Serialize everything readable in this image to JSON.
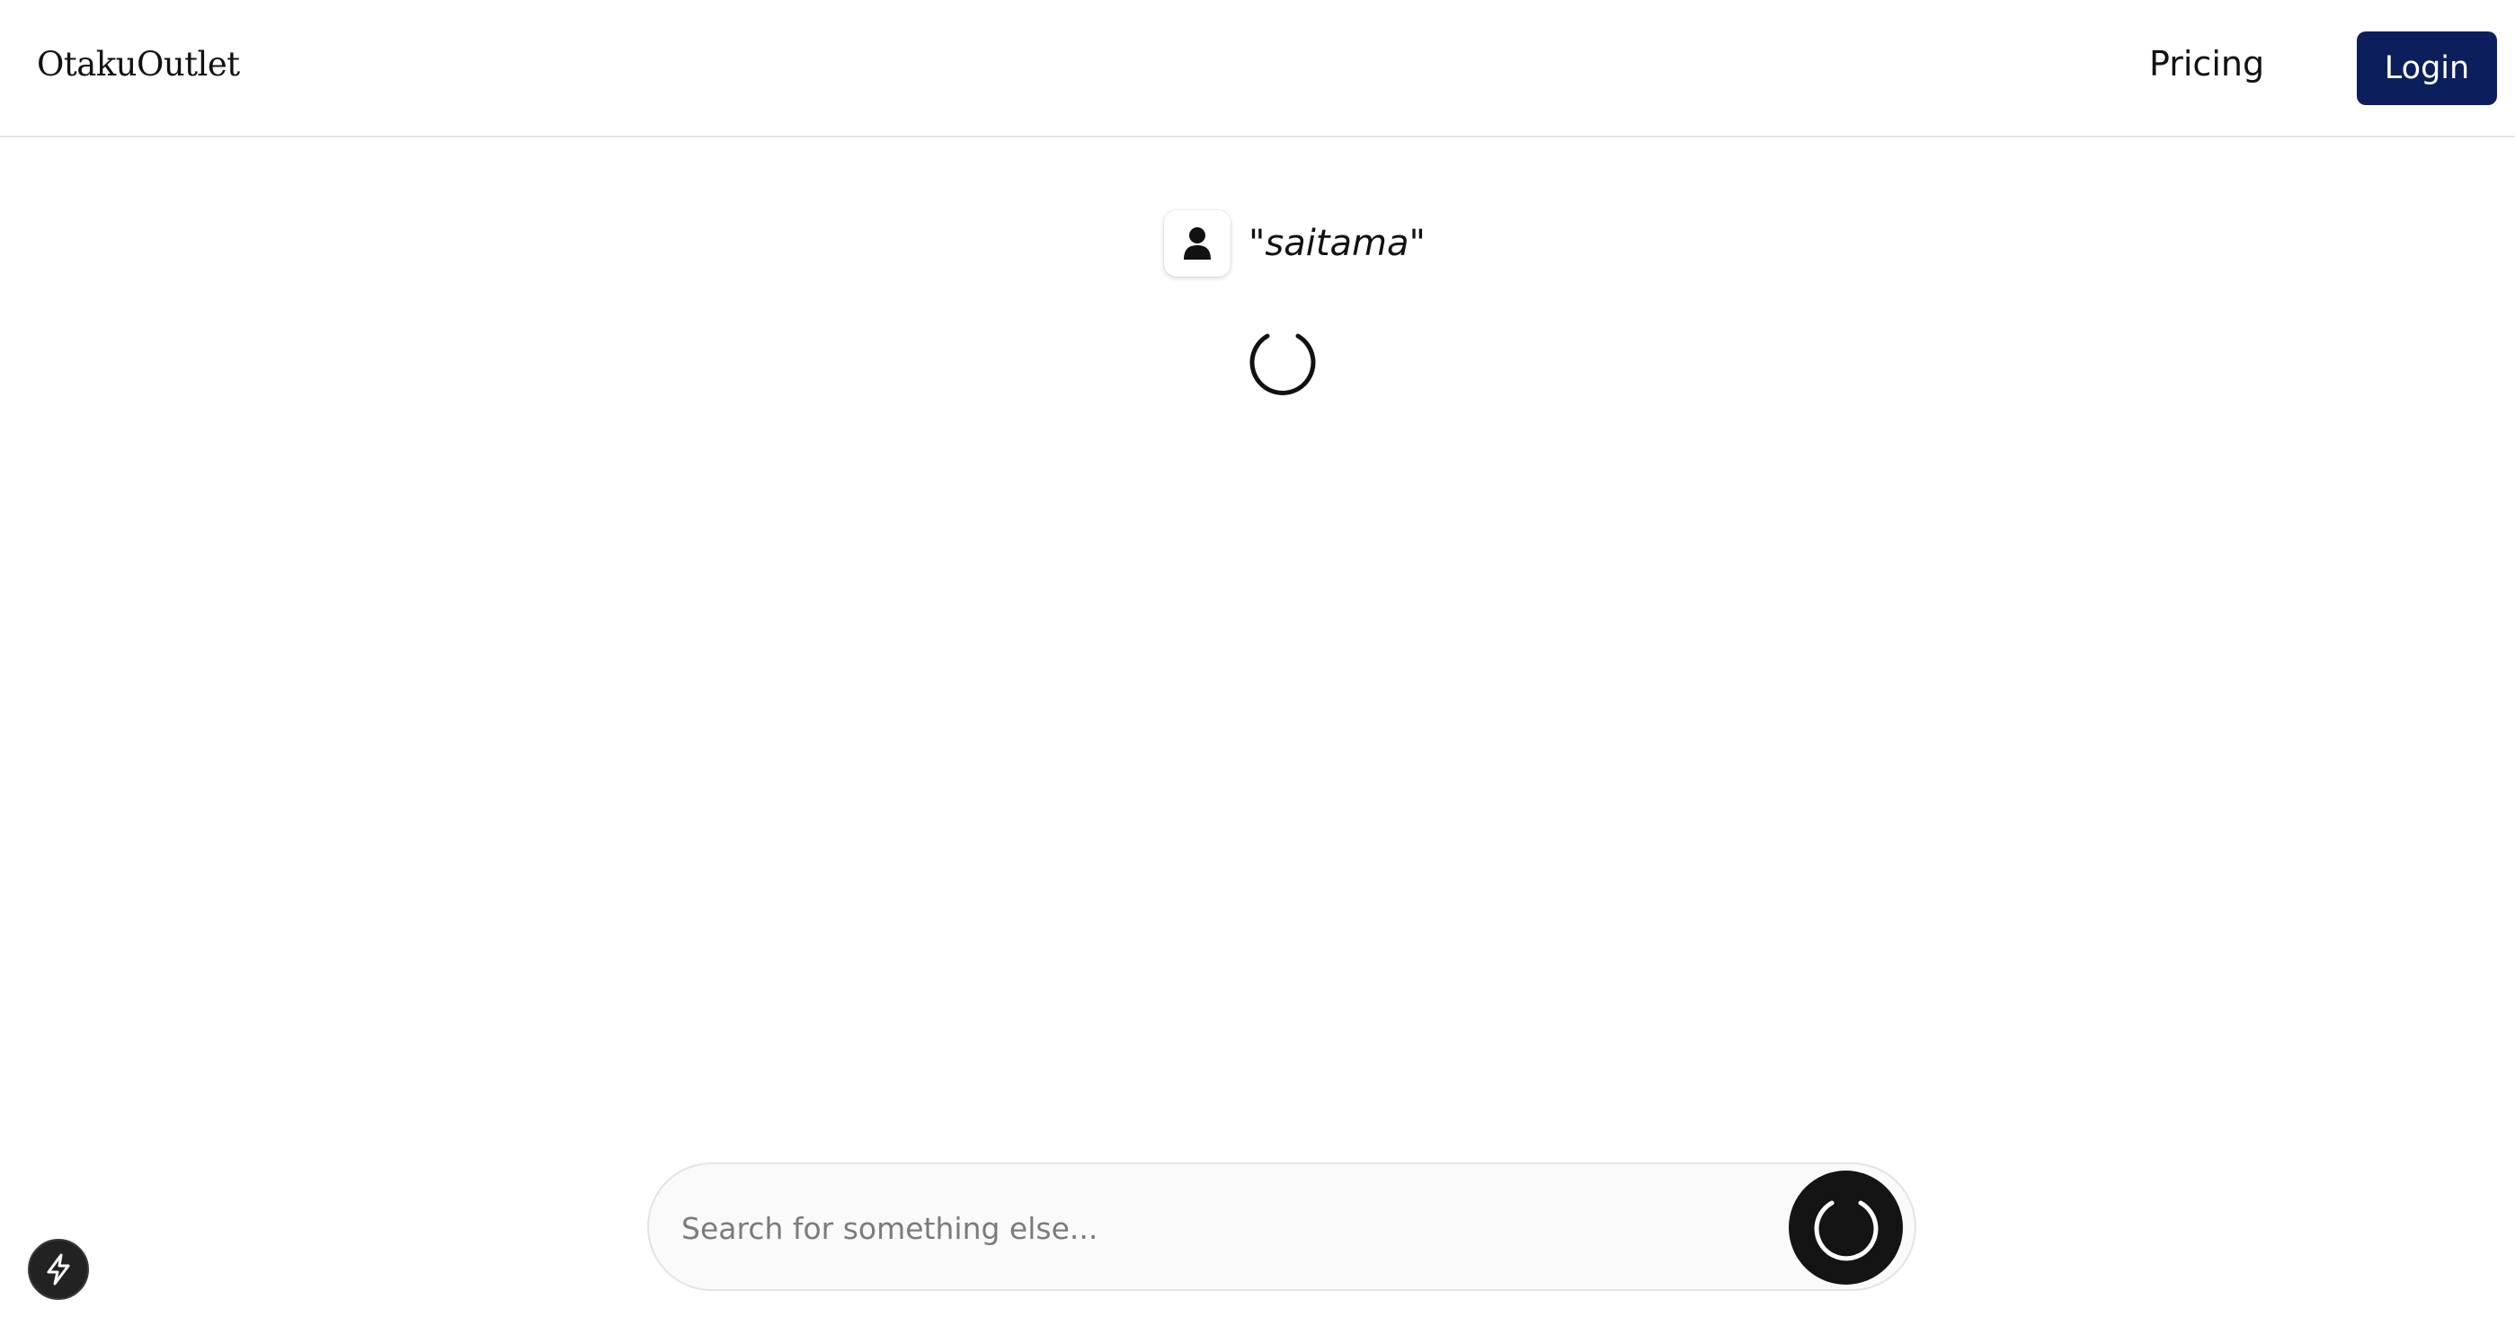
{
  "header": {
    "brand": "OtakuOutlet",
    "nav": {
      "pricing_label": "Pricing"
    },
    "login_label": "Login"
  },
  "query": {
    "text": "\"saitama\"",
    "icon": "user-icon"
  },
  "status": {
    "loading_icon": "spinner-icon"
  },
  "search": {
    "placeholder": "Search for something else...",
    "value": "",
    "submit_icon": "spinner-icon"
  },
  "fab": {
    "icon": "lightning-icon"
  },
  "colors": {
    "accent": "#0c1f5c",
    "dark": "#141414",
    "border": "#e3e3e3"
  }
}
